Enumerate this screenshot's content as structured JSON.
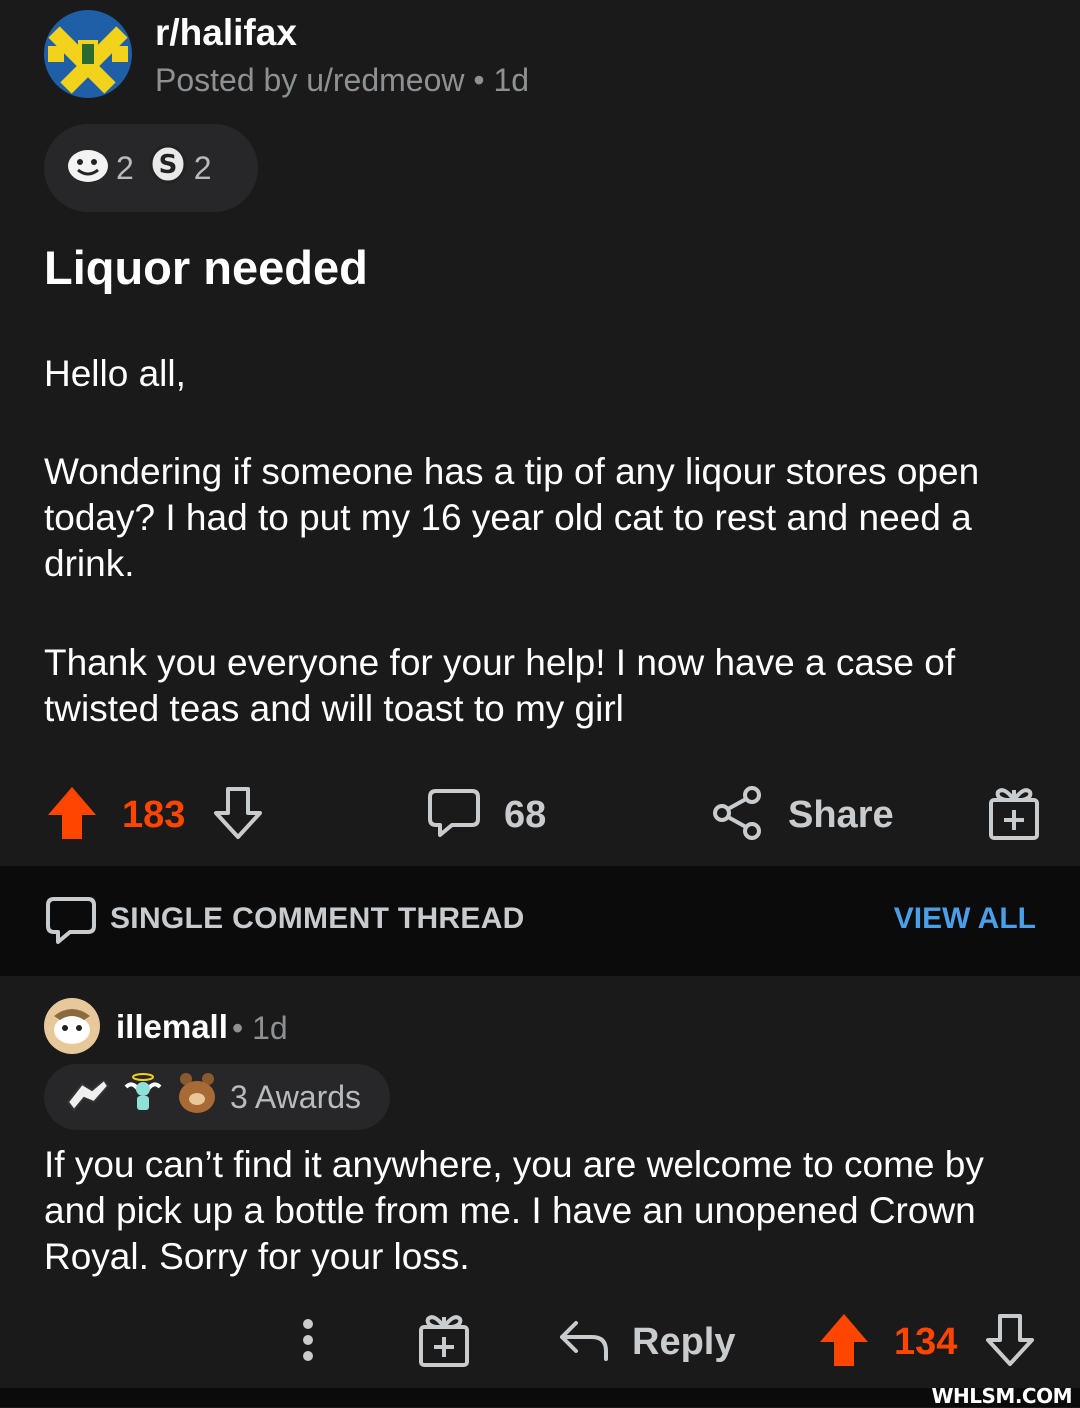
{
  "post": {
    "subreddit": "r/halifax",
    "posted_by": "Posted by u/redmeow",
    "age": "1d",
    "awards": [
      {
        "icon": "wholesome-award-icon",
        "count": "2"
      },
      {
        "icon": "silver-coin-award-icon",
        "count": "2"
      }
    ],
    "title": "Liquor needed",
    "body": [
      "Hello all,",
      "Wondering if someone has a tip of any liqour stores open today? I had to put my 16 year old cat to rest and need a drink.",
      "Thank you everyone for your help! I now have a case of twisted teas and will toast to my girl"
    ],
    "score": "183",
    "comments": "68",
    "share_label": "Share",
    "colors": {
      "upvote": "#ff4500",
      "link": "#4a9fe8"
    }
  },
  "thread": {
    "label": "SINGLE COMMENT THREAD",
    "view_all": "VIEW ALL"
  },
  "comment": {
    "user": "illemall",
    "age": "1d",
    "awards_icons": [
      "helping-hand-award-icon",
      "angel-award-icon",
      "bear-hug-award-icon"
    ],
    "awards_label": "3 Awards",
    "text": "If you can’t find it anywhere, you are welcome to come by and pick up a bottle from me. I have an unopened Crown Royal. Sorry for your loss.",
    "reply_label": "Reply",
    "score": "134"
  },
  "watermark": "WHLSM.COM"
}
